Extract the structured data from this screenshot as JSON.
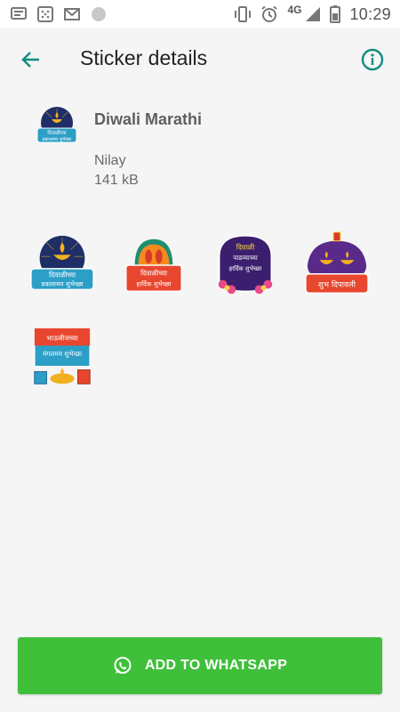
{
  "status_bar": {
    "network": "4G",
    "time": "10:29"
  },
  "app_bar": {
    "title": "Sticker details",
    "back_icon": "arrow-back-icon",
    "info_icon": "info-icon"
  },
  "pack": {
    "name": "Diwali Marathi",
    "publisher": "Nilay",
    "size": "141 kB",
    "tray_text": [
      "दिवाळीच्या",
      "प्रकाशमय शुभेच्छा"
    ]
  },
  "stickers": [
    {
      "lines": [
        "दिवाळीच्या",
        "प्रकाशमय शुभेच्छा"
      ]
    },
    {
      "lines": [
        "दिवाळीच्या",
        "हार्दिक शुभेच्छा"
      ]
    },
    {
      "lines": [
        "दिवाळी",
        "पाडव्याच्या",
        "हार्दिक शुभेच्छा"
      ]
    },
    {
      "lines": [
        "शुभ दिपावली"
      ]
    },
    {
      "lines": [
        "भाऊबीजच्या",
        "मंगलमय शुभेच्छा"
      ]
    }
  ],
  "add_button": {
    "label": "ADD TO WHATSAPP",
    "icon": "whatsapp-icon"
  },
  "colors": {
    "accent": "#128c7e",
    "button": "#3fbf3a"
  }
}
